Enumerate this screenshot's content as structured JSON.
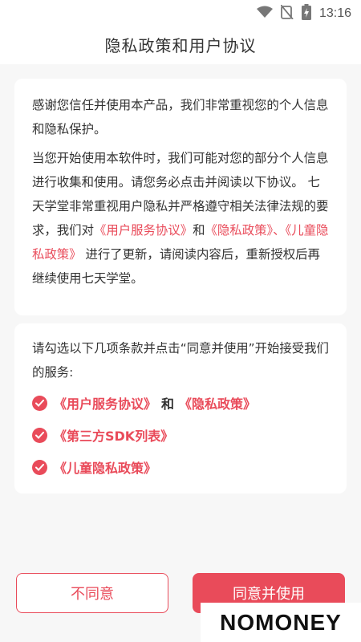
{
  "status_bar": {
    "time": "13:16"
  },
  "header": {
    "title": "隐私政策和用户协议"
  },
  "intro": {
    "para1": "感谢您信任并使用本产品，我们非常重视您的个人信息和隐私保护。",
    "para2_text1": "当您开始使用本软件时，我们可能对您的部分个人信息进行收集和使用。请您务必点击并阅读以下协议。 七天学堂非常重视用户隐私并严格遵守相关法律法规的要求，我们对",
    "link_user_agreement": "《用户服务协议》",
    "and1": "和",
    "link_privacy": "《隐私政策》、《儿童隐私政策》",
    "para2_text2": " 进行了更新，请阅读内容后，重新授权后再继续使用七天学堂。"
  },
  "terms": {
    "instruction": "请勾选以下几项条款并点击“同意并使用”开始接受我们的服务:",
    "items": [
      {
        "link1": "《用户服务协议》",
        "and": "和",
        "link2": "《隐私政策》",
        "checked": true
      },
      {
        "link1": "《第三方SDK列表》",
        "checked": true
      },
      {
        "link1": "《儿童隐私政策》",
        "checked": true
      }
    ]
  },
  "buttons": {
    "disagree": "不同意",
    "agree": "同意并使用"
  },
  "watermark": {
    "text": "NOMONEY"
  },
  "colors": {
    "accent": "#e94b5a",
    "background": "#f7f7f7",
    "card": "#ffffff"
  },
  "icons": [
    "wifi-icon",
    "no-sim-icon",
    "battery-charging-icon",
    "check-circle-icon"
  ]
}
